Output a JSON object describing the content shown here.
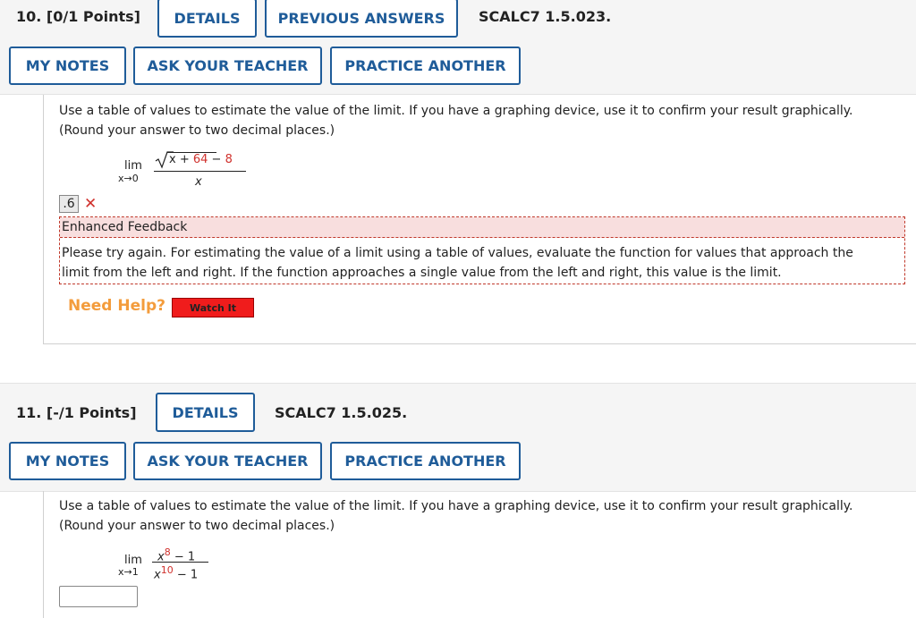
{
  "q10": {
    "number": "10.",
    "points": "[0/1 Points]",
    "details": "DETAILS",
    "previous_answers": "PREVIOUS ANSWERS",
    "code": "SCALC7 1.5.023.",
    "my_notes": "MY NOTES",
    "ask_teacher": "ASK YOUR TEACHER",
    "practice_another": "PRACTICE ANOTHER",
    "text_line1": "Use a table of values to estimate the value of the limit. If you have a graphing device, use it to confirm your result graphically.",
    "text_line2": "(Round your answer to two decimal places.)",
    "limit_word": "lim",
    "limit_sub": "x→0",
    "numer_a": "x + ",
    "numer_b": "64",
    "numer_c": " − ",
    "numer_d": "8",
    "denom": "x",
    "answer_value": ".6",
    "feedback_title": "Enhanced Feedback",
    "feedback_line1": "Please try again. For estimating the value of a limit using a table of values, evaluate the function for values that approach the",
    "feedback_line2": "limit from the left and right. If the function approaches a single value from the left and right, this value is the limit.",
    "need_help": "Need Help?",
    "watch_it": "Watch It"
  },
  "q11": {
    "number": "11.",
    "points": "[-/1 Points]",
    "details": "DETAILS",
    "code": "SCALC7 1.5.025.",
    "my_notes": "MY NOTES",
    "ask_teacher": "ASK YOUR TEACHER",
    "practice_another": "PRACTICE ANOTHER",
    "text_line1": "Use a table of values to estimate the value of the limit. If you have a graphing device, use it to confirm your result graphically.",
    "text_line2": "(Round your answer to two decimal places.)",
    "limit_word": "lim",
    "limit_sub": "x→1",
    "numer_base": "x",
    "numer_exp": "8",
    "numer_rest": " − 1",
    "denom_base": "x",
    "denom_exp": "10",
    "denom_rest": " − 1",
    "answer_value": ""
  },
  "colors": {
    "accent": "#1f5c99",
    "error": "#d0312d",
    "help": "#f39c3c",
    "watch_bg": "#f01c1c"
  }
}
